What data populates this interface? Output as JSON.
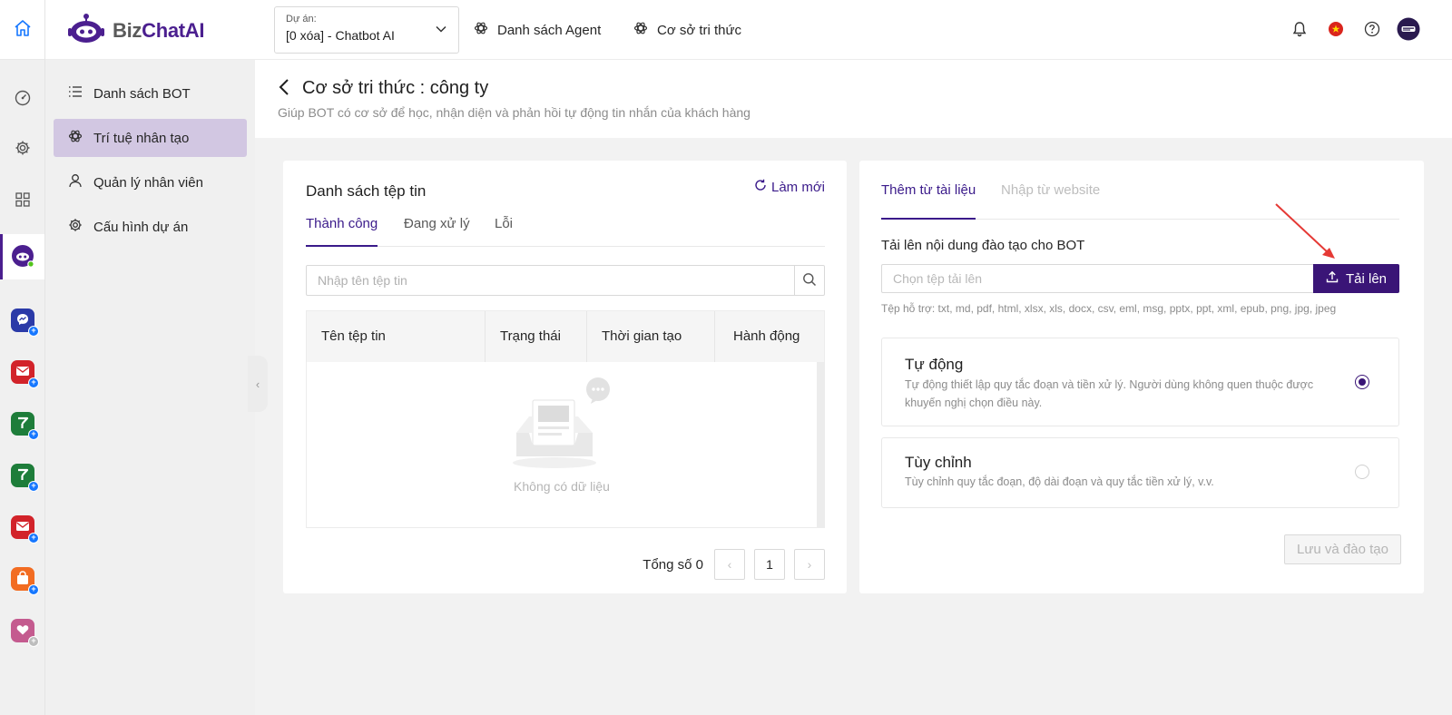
{
  "header": {
    "logo_biz": "Biz",
    "logo_chat": "ChatAI",
    "project_label": "Dự án:",
    "project_value": "[0 xóa] - Chatbot AI",
    "nav": [
      "Danh sách Agent",
      "Cơ sở tri thức"
    ]
  },
  "sidebar": {
    "items": [
      {
        "label": "Danh sách BOT",
        "icon": "list-icon"
      },
      {
        "label": "Trí tuệ nhân tạo",
        "icon": "openai-icon",
        "active": true
      },
      {
        "label": "Quản lý nhân viên",
        "icon": "user-icon"
      },
      {
        "label": "Cấu hình dự án",
        "icon": "gear-icon"
      }
    ]
  },
  "rail": {
    "icons": [
      "home-icon",
      "dashboard-icon",
      "gear-icon",
      "grid-icon",
      "bot-icon"
    ],
    "channels": [
      "messenger-icon",
      "gmail-icon",
      "zalo-icon",
      "zalo-icon",
      "gmail-icon",
      "shop-icon",
      "chat-heart-icon"
    ]
  },
  "page": {
    "title": "Cơ sở tri thức : công ty",
    "subtitle": "Giúp BOT có cơ sở để học, nhận diện và phản hồi tự động tin nhắn của khách hàng"
  },
  "files": {
    "title": "Danh sách tệp tin",
    "refresh": "Làm mới",
    "tabs": [
      "Thành công",
      "Đang xử lý",
      "Lỗi"
    ],
    "search_placeholder": "Nhập tên tệp tin",
    "columns": [
      "Tên tệp tin",
      "Trạng thái",
      "Thời gian tạo",
      "Hành động"
    ],
    "empty": "Không có dữ liệu",
    "total_label": "Tổng số 0",
    "current_page": "1"
  },
  "upload": {
    "tabs": [
      "Thêm từ tài liệu",
      "Nhập từ website"
    ],
    "label": "Tải lên nội dung đào tạo cho BOT",
    "placeholder": "Chọn tệp tải lên",
    "button": "Tải lên",
    "supported": "Tệp hỗ trợ: txt, md, pdf, html, xlsx, xls, docx, csv, eml, msg, pptx, ppt, xml, epub, png, jpg, jpeg",
    "options": [
      {
        "title": "Tự động",
        "desc": "Tự động thiết lập quy tắc đoạn và tiền xử lý. Người dùng không quen thuộc được khuyến nghị chọn điều này.",
        "checked": true
      },
      {
        "title": "Tùy chỉnh",
        "desc": "Tùy chỉnh quy tắc đoạn, độ dài đoạn và quy tắc tiền xử lý, v.v.",
        "checked": false
      }
    ],
    "save_button": "Lưu và đào tạo"
  },
  "colors": {
    "brand": "#3a1577",
    "active_menu_bg": "#d2c7e2",
    "annotation_arrow": "#e53935"
  }
}
